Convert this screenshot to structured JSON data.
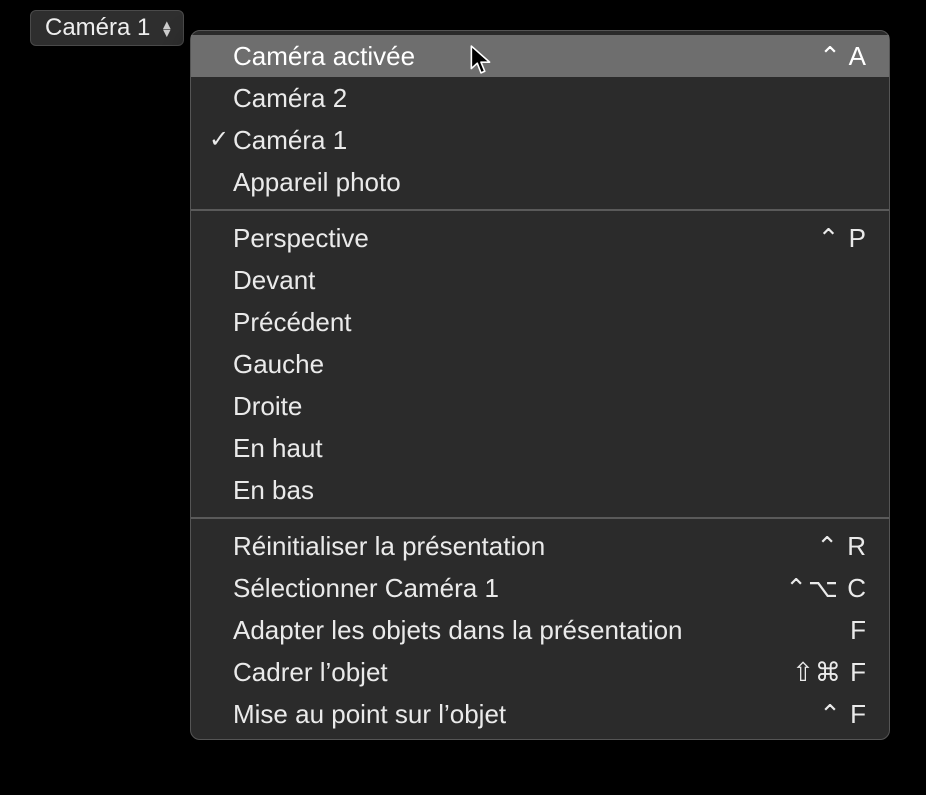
{
  "dropdown": {
    "label": "Caméra 1"
  },
  "menu": {
    "sections": [
      {
        "items": [
          {
            "id": "camera-active",
            "label": "Caméra activée",
            "shortcut": "⌃ A",
            "checked": false,
            "highlighted": true
          },
          {
            "id": "camera-2",
            "label": "Caméra 2",
            "shortcut": "",
            "checked": false,
            "highlighted": false
          },
          {
            "id": "camera-1",
            "label": "Caméra 1",
            "shortcut": "",
            "checked": true,
            "highlighted": false
          },
          {
            "id": "camera-appareil",
            "label": "Appareil photo",
            "shortcut": "",
            "checked": false,
            "highlighted": false
          }
        ]
      },
      {
        "items": [
          {
            "id": "view-perspective",
            "label": "Perspective",
            "shortcut": "⌃ P",
            "checked": false,
            "highlighted": false
          },
          {
            "id": "view-front",
            "label": "Devant",
            "shortcut": "",
            "checked": false,
            "highlighted": false
          },
          {
            "id": "view-back",
            "label": "Précédent",
            "shortcut": "",
            "checked": false,
            "highlighted": false
          },
          {
            "id": "view-left",
            "label": "Gauche",
            "shortcut": "",
            "checked": false,
            "highlighted": false
          },
          {
            "id": "view-right",
            "label": "Droite",
            "shortcut": "",
            "checked": false,
            "highlighted": false
          },
          {
            "id": "view-top",
            "label": "En haut",
            "shortcut": "",
            "checked": false,
            "highlighted": false
          },
          {
            "id": "view-bottom",
            "label": "En bas",
            "shortcut": "",
            "checked": false,
            "highlighted": false
          }
        ]
      },
      {
        "items": [
          {
            "id": "reset-view",
            "label": "Réinitialiser la présentation",
            "shortcut": "⌃ R",
            "checked": false,
            "highlighted": false
          },
          {
            "id": "select-camera",
            "label": "Sélectionner Caméra 1",
            "shortcut": "⌃⌥ C",
            "checked": false,
            "highlighted": false
          },
          {
            "id": "fit-objects",
            "label": "Adapter les objets dans la présentation",
            "shortcut": "F",
            "checked": false,
            "highlighted": false
          },
          {
            "id": "frame-object",
            "label": "Cadrer l’objet",
            "shortcut": "⇧⌘ F",
            "checked": false,
            "highlighted": false
          },
          {
            "id": "focus-object",
            "label": "Mise au point sur l’objet",
            "shortcut": "⌃ F",
            "checked": false,
            "highlighted": false
          }
        ]
      }
    ]
  }
}
